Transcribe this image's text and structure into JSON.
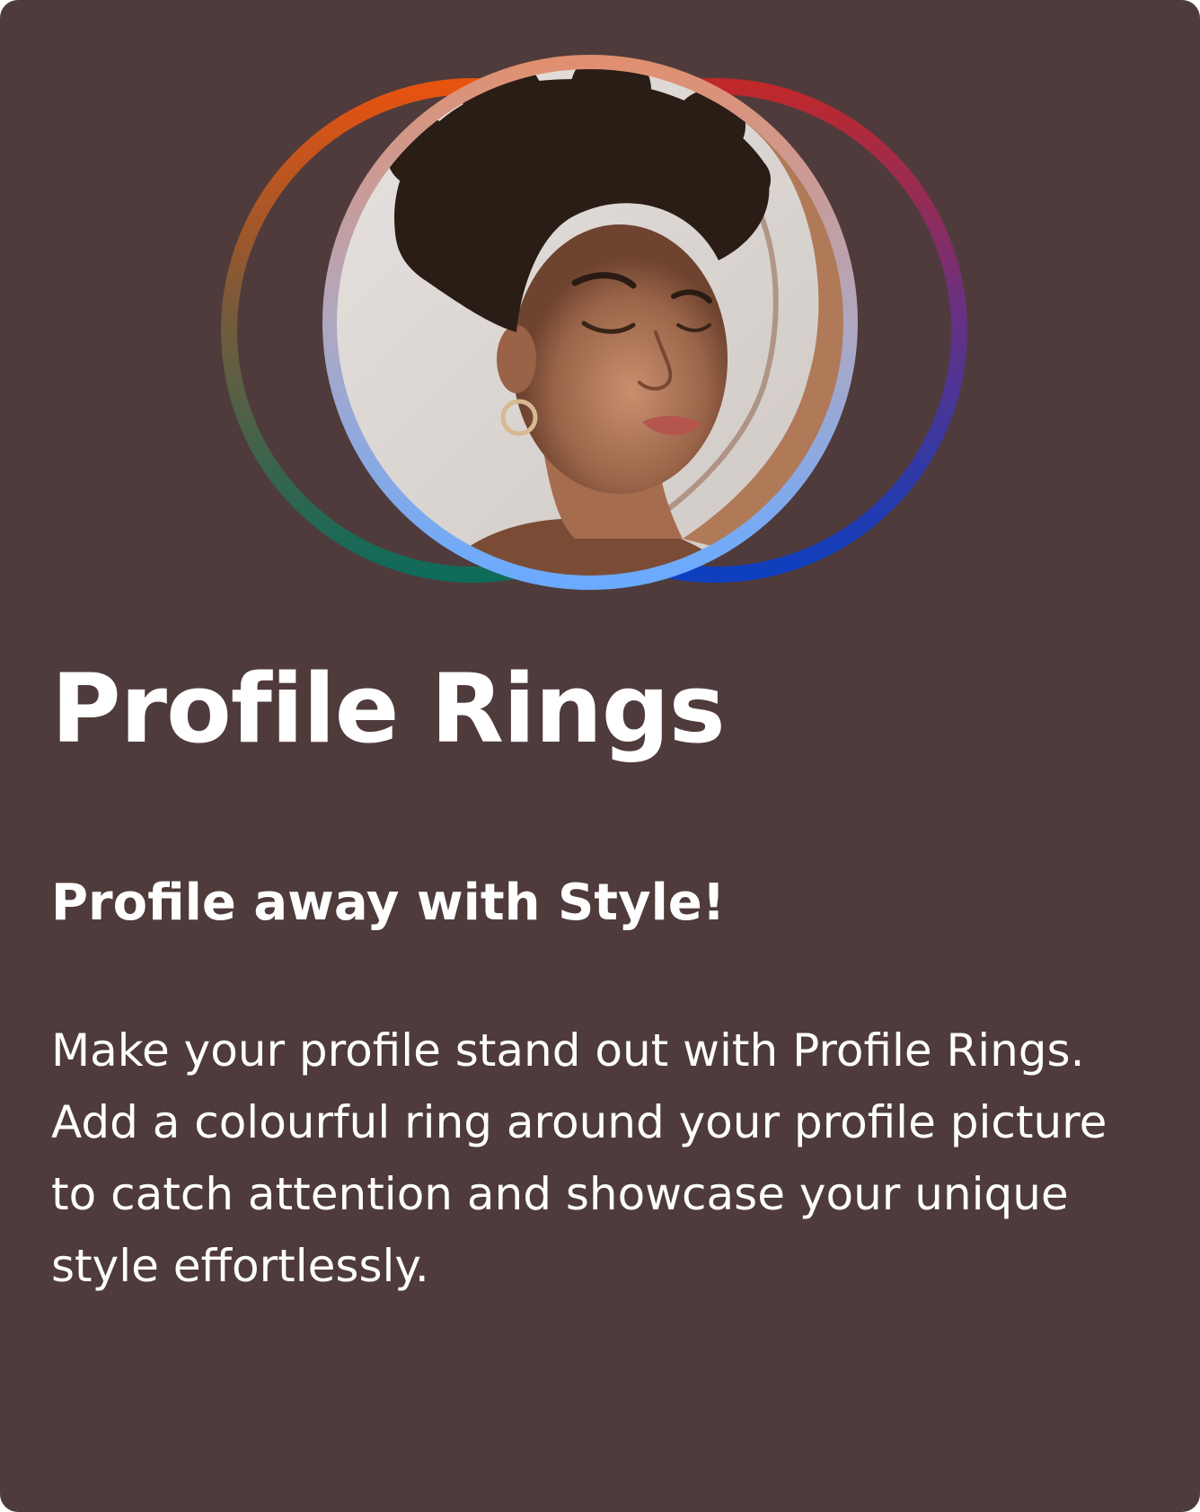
{
  "card": {
    "title": "Profile Rings",
    "subtitle": "Profile away with Style!",
    "description": "Make your profile stand out with Profile Rings. Add a colourful ring around your profile picture to catch attention and showcase your unique style effortlessly."
  },
  "colors": {
    "background": "#4f3b3b",
    "text": "#ffffff",
    "ring_left": [
      "#e8520f",
      "#0f6b5a"
    ],
    "ring_right": [
      "#c0282a",
      "#0d3fbf"
    ],
    "ring_front": [
      "#e09070",
      "#6aaaff"
    ]
  },
  "hero": {
    "image": "profile-photo-woman-curly-hair"
  }
}
